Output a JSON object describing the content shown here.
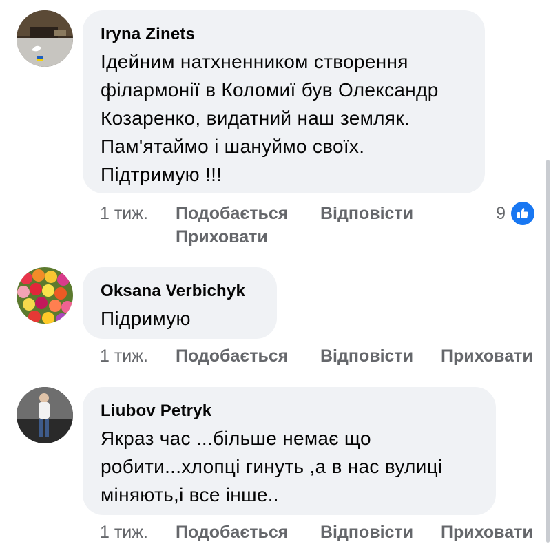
{
  "comments": [
    {
      "author": "Iryna Zinets",
      "lines": [
        "Ідейним натхненником  створення",
        "філармонії в Коломиї був Олександр",
        "Козаренко, видатний наш земляк.",
        "Пам'ятаймо і шануймо своїх.",
        "Підтримую !!!"
      ],
      "time": "1 тиж.",
      "like": "Подобається",
      "reply": "Відповісти",
      "hide": "Приховати",
      "reaction_count": "9"
    },
    {
      "author": "Oksana Verbichyk",
      "lines": [
        "Підримую"
      ],
      "time": "1 тиж.",
      "like": "Подобається",
      "reply": "Відповісти",
      "hide": "Приховати"
    },
    {
      "author": "Liubov Petryk",
      "lines": [
        "Якраз час ...більше немає що",
        "робити...хлопці гинуть ,а в нас вулиці",
        "міняють,і все інше.."
      ],
      "time": "1 тиж.",
      "like": "Подобається",
      "reply": "Відповісти",
      "hide": "Приховати"
    }
  ],
  "icons": {
    "reaction": "like-thumbs-up-icon"
  },
  "colors": {
    "bubble": "#f0f2f5",
    "meta_text": "#65676b",
    "like_blue": "#1877f2"
  }
}
